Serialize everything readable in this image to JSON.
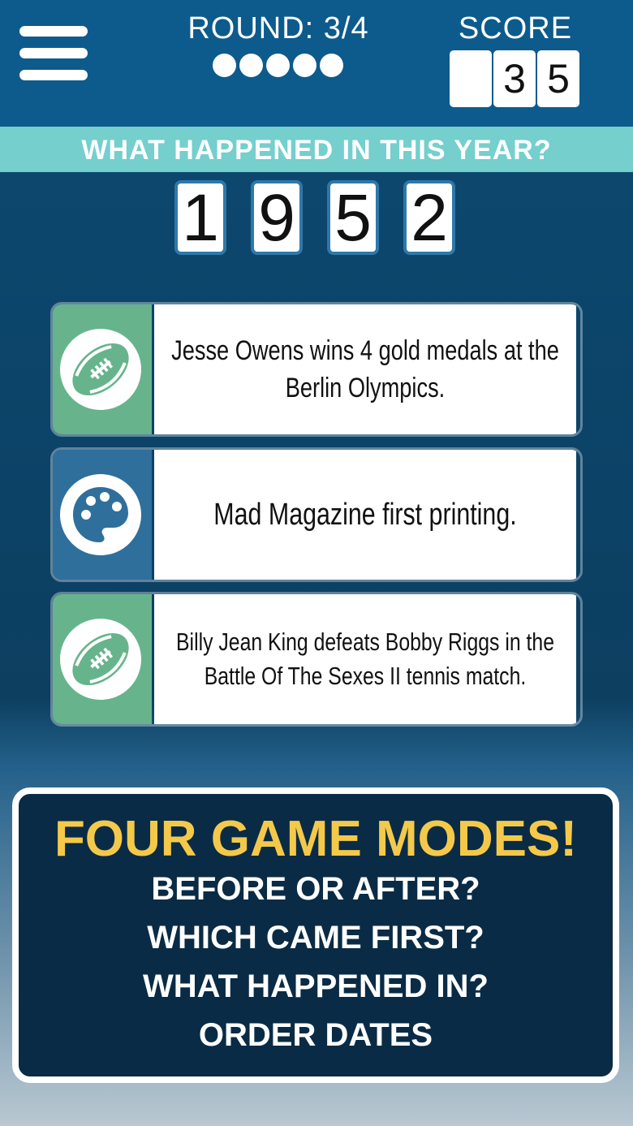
{
  "header": {
    "round_label": "ROUND: 3/4",
    "round_dots": 5,
    "score_label": "SCORE",
    "score_digits": [
      "",
      "3",
      "5"
    ]
  },
  "question": {
    "prompt": "WHAT HAPPENED IN THIS YEAR?",
    "year_digits": [
      "1",
      "9",
      "5",
      "2"
    ]
  },
  "options": [
    {
      "category_icon": "football-icon",
      "category_color": "#67b48c",
      "text": "Jesse Owens wins 4 gold medals at the Berlin Olympics."
    },
    {
      "category_icon": "palette-icon",
      "category_color": "#2f6f9c",
      "text": "Mad Magazine first printing."
    },
    {
      "category_icon": "football-icon",
      "category_color": "#67b48c",
      "text": "Billy Jean King defeats Bobby Riggs in the Battle Of The Sexes II tennis match."
    }
  ],
  "promo": {
    "title": "FOUR GAME MODES!",
    "modes": [
      "BEFORE OR AFTER?",
      "WHICH CAME FIRST?",
      "WHAT HAPPENED IN?",
      "ORDER DATES"
    ]
  },
  "colors": {
    "header_bg": "#0d5b8c",
    "question_bar": "#74cfcd",
    "accent_yellow": "#f4c94a",
    "sports_green": "#67b48c",
    "arts_blue": "#2f6f9c"
  }
}
